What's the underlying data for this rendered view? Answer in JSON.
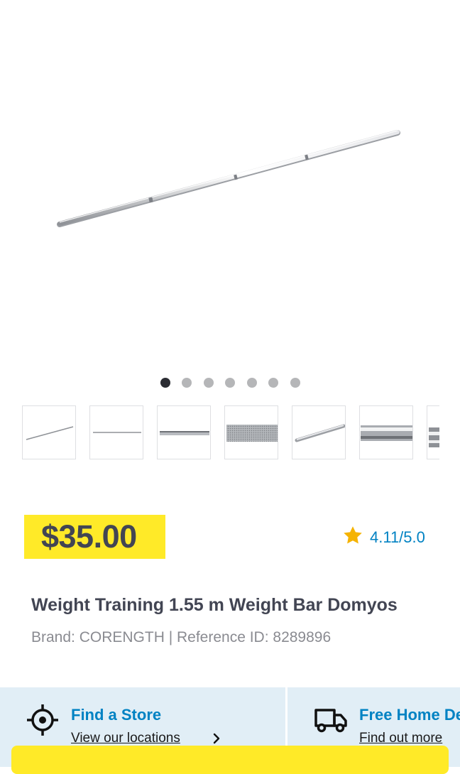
{
  "product": {
    "price": "$35.00",
    "rating_text": "4.11/5.0",
    "title": "Weight Training 1.55 m Weight Bar Domyos",
    "brand_line": "Brand: CORENGTH | Reference ID: 8289896"
  },
  "gallery": {
    "dot_count": 7,
    "active_index": 0,
    "thumbnail_count": 7
  },
  "services": {
    "store": {
      "title": "Find a Store",
      "link": "View our locations",
      "icon": "crosshair-icon"
    },
    "delivery": {
      "title": "Free Home Delivery",
      "link": "Find out more",
      "icon": "truck-icon"
    }
  },
  "colors": {
    "brand_yellow": "#ffea28",
    "brand_blue": "#0082c3",
    "text_dark": "#424553",
    "star": "#f5b301"
  }
}
